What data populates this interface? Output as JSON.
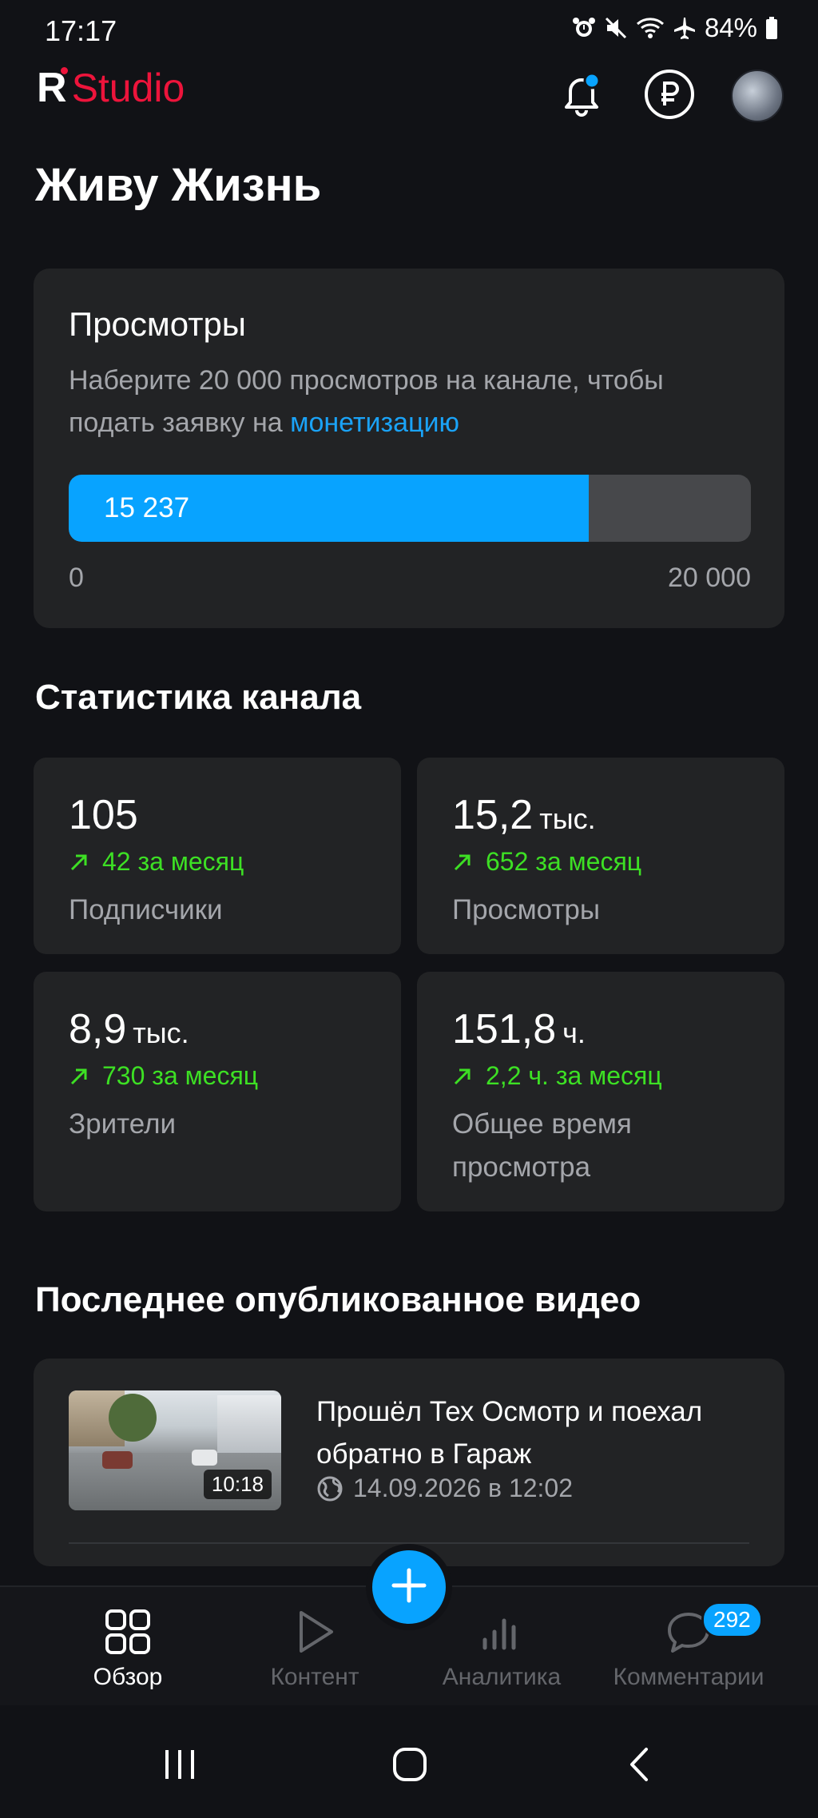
{
  "status_bar": {
    "time": "17:17",
    "battery": "84%",
    "icons": [
      "alarm-icon",
      "mute-icon",
      "wifi-icon",
      "airplane-icon",
      "battery-icon"
    ]
  },
  "app": {
    "logo_letter": "R",
    "logo_word": "Studio",
    "brand_color": "#ed143b",
    "accent_color": "#08a3ff",
    "positive_color": "#3de024"
  },
  "header": {
    "icons": [
      "bell-icon",
      "ruble-icon",
      "avatar"
    ]
  },
  "channel": {
    "name": "Живу Жизнь"
  },
  "views_card": {
    "title": "Просмотры",
    "description_prefix": "Наберите 20 000 просмотров на канале, чтобы подать заявку на ",
    "description_link": "монетизацию",
    "progress_label": "15 237",
    "progress_value": 15237,
    "progress_max": 20000,
    "min_label": "0",
    "max_label": "20 000"
  },
  "stats": {
    "section_title": "Статистика канала",
    "tiles": [
      {
        "value": "105",
        "unit": "",
        "delta": "42 за месяц",
        "label": "Подписчики"
      },
      {
        "value": "15,2",
        "unit": "тыс.",
        "delta": "652 за месяц",
        "label": "Просмотры"
      },
      {
        "value": "8,9",
        "unit": "тыс.",
        "delta": "730 за месяц",
        "label": "Зрители"
      },
      {
        "value": "151,8",
        "unit": "ч.",
        "delta": "2,2 ч. за месяц",
        "label": "Общее время просмотра"
      }
    ]
  },
  "last_video": {
    "section_title": "Последнее опубликованное видео",
    "title": "Прошёл Тех Осмотр и поехал обратно в Гараж",
    "duration": "10:18",
    "date": "14.09.2026 в 12:02"
  },
  "bottom_nav": {
    "items": [
      {
        "label": "Обзор",
        "icon": "grid-icon",
        "active": true
      },
      {
        "label": "Контент",
        "icon": "play-icon",
        "active": false
      },
      {
        "label": "Аналитика",
        "icon": "analytics-icon",
        "active": false
      },
      {
        "label": "Комментарии",
        "icon": "comment-icon",
        "active": false,
        "badge": "292"
      }
    ],
    "fab_icon": "plus-icon"
  },
  "system_nav": {
    "icons": [
      "recents-icon",
      "home-icon",
      "back-icon"
    ]
  }
}
